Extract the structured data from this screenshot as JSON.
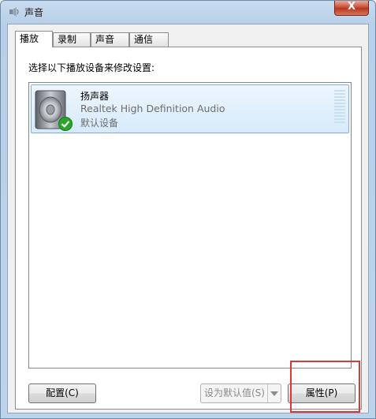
{
  "window": {
    "title": "声音",
    "close_label": "X"
  },
  "tabs": [
    {
      "label": "播放",
      "active": true
    },
    {
      "label": "录制",
      "active": false
    },
    {
      "label": "声音",
      "active": false
    },
    {
      "label": "通信",
      "active": false
    }
  ],
  "playback": {
    "instruction": "选择以下播放设备来修改设置:",
    "devices": [
      {
        "name": "扬声器",
        "driver": "Realtek High Definition Audio",
        "status": "默认设备",
        "icon": "speaker-icon",
        "badge_icon": "check-icon"
      }
    ]
  },
  "buttons": {
    "configure": "配置(C)",
    "set_default": "设为默认值(S)",
    "properties": "属性(P)"
  },
  "colors": {
    "highlight": "#d23c3c",
    "selection": "#d6eafb"
  }
}
